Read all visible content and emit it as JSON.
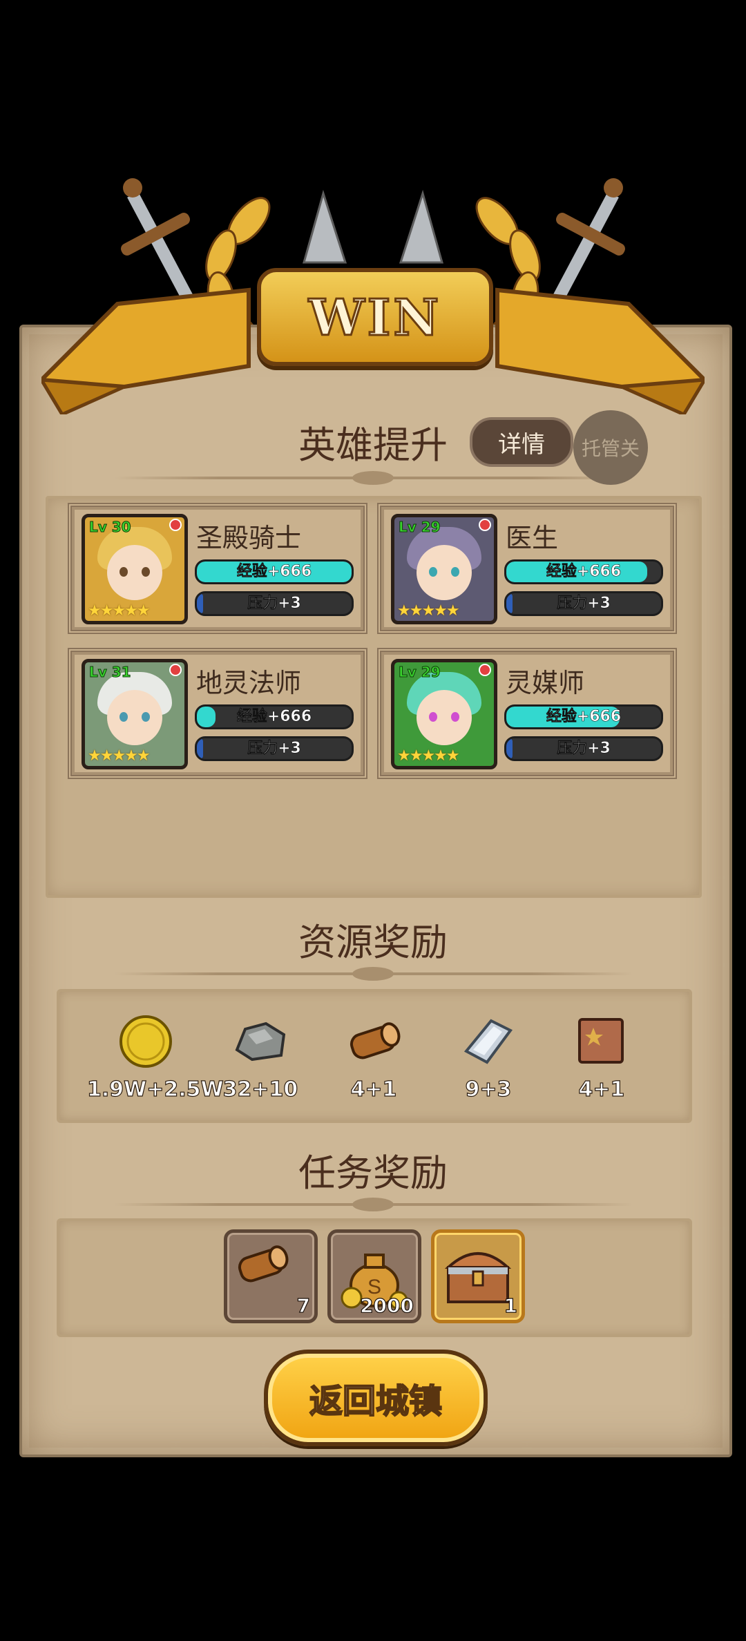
{
  "banner": {
    "title": "WIN"
  },
  "hero_section": {
    "title": "英雄提升",
    "details_label": "详情",
    "auto_label": "托管关"
  },
  "heroes": [
    {
      "name": "圣殿骑士",
      "level": "Lv 30",
      "stars": "★★★★★",
      "exp_label": "经验+666",
      "exp_fill": 1.0,
      "stress_label": "压力+3",
      "stress_fill": 0.03,
      "hair": "#e9c35a",
      "eye": "#6b4a2a",
      "bg": "#d9a63a"
    },
    {
      "name": "医生",
      "level": "Lv 29",
      "stars": "★★★★★",
      "exp_label": "经验+666",
      "exp_fill": 0.91,
      "stress_label": "压力+3",
      "stress_fill": 0.03,
      "hair": "#8c82a8",
      "eye": "#3ba7b0",
      "bg": "#5d5a72"
    },
    {
      "name": "地灵法师",
      "level": "Lv 31",
      "stars": "★★★★★",
      "exp_label": "经验+666",
      "exp_fill": 0.12,
      "stress_label": "压力+3",
      "stress_fill": 0.03,
      "hair": "#e8eae6",
      "eye": "#4a9ab0",
      "bg": "#7c9a78"
    },
    {
      "name": "灵媒师",
      "level": "Lv 29",
      "stars": "★★★★★",
      "exp_label": "经验+666",
      "exp_fill": 0.73,
      "stress_label": "压力+3",
      "stress_fill": 0.03,
      "hair": "#5fd6b8",
      "eye": "#d04fd0",
      "bg": "#3f9a3a"
    }
  ],
  "resources": {
    "title": "资源奖励",
    "items": [
      {
        "icon": "gold-coin-icon",
        "amount": "1.9W+2.5W"
      },
      {
        "icon": "ore-icon",
        "amount": "32+10"
      },
      {
        "icon": "wood-log-icon",
        "amount": "4+1"
      },
      {
        "icon": "iron-ingot-icon",
        "amount": "9+3"
      },
      {
        "icon": "leather-icon",
        "amount": "4+1"
      }
    ]
  },
  "tasks": {
    "title": "任务奖励",
    "items": [
      {
        "icon": "wood-log-icon",
        "count": "7"
      },
      {
        "icon": "money-bag-icon",
        "count": "2000"
      },
      {
        "icon": "treasure-chest-icon",
        "count": "1"
      }
    ]
  },
  "return_button": {
    "label": "返回城镇"
  },
  "colors": {
    "exp": "#33d8cf",
    "stress": "#2f5fb8"
  }
}
